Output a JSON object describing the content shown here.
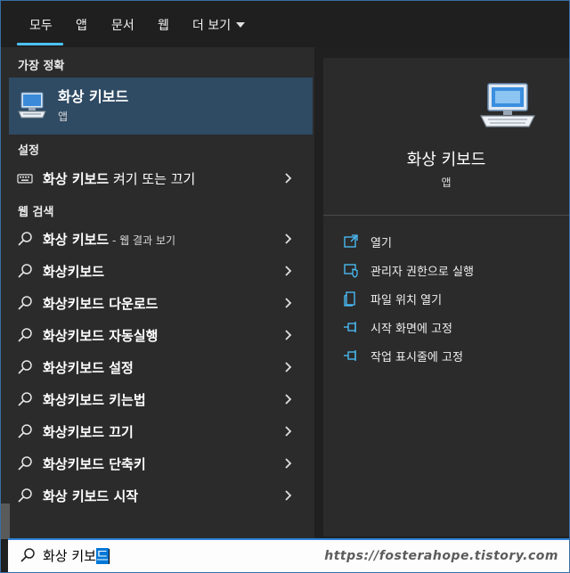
{
  "tabs": [
    {
      "label": "모두",
      "active": true
    },
    {
      "label": "앱"
    },
    {
      "label": "문서"
    },
    {
      "label": "웹"
    },
    {
      "label": "더 보기"
    }
  ],
  "best_match": {
    "section": "가장 정확",
    "title": "화상 키보드",
    "subtitle": "앱",
    "icon": "on-screen-keyboard-icon"
  },
  "settings": {
    "section": "설정",
    "item": {
      "bold": "화상 키보드",
      "rest": " 켜기 또는 끄기",
      "icon": "keyboard-icon"
    }
  },
  "web": {
    "section": "웹 검색",
    "items": [
      {
        "bold": "화상 키보드",
        "small": " - 웹 결과 보기"
      },
      {
        "bold": "화상키보드"
      },
      {
        "bold": "화상키보드 다운로드"
      },
      {
        "bold": "화상키보드 자동실행"
      },
      {
        "bold": "화상키보드 설정"
      },
      {
        "bold": "화상키보드 키는법"
      },
      {
        "bold": "화상키보드 끄기"
      },
      {
        "bold": "화상키보드 단축키"
      },
      {
        "bold": "화상 키보드 시작"
      }
    ]
  },
  "preview": {
    "title": "화상 키보드",
    "subtitle": "앱",
    "actions": [
      {
        "label": "열기",
        "icon": "open-icon"
      },
      {
        "label": "관리자 권한으로 실행",
        "icon": "shield-admin-icon"
      },
      {
        "label": "파일 위치 열기",
        "icon": "file-location-icon"
      },
      {
        "label": "시작 화면에 고정",
        "icon": "pin-icon"
      },
      {
        "label": "작업 표시줄에 고정",
        "icon": "pin-taskbar-icon"
      }
    ]
  },
  "search": {
    "typed": "화상 키보",
    "selected": "드"
  },
  "watermark": "https://fosterahope.tistory.com",
  "colors": {
    "accent": "#4cc2ff",
    "selection": "#0078d7",
    "best_bg": "#2f4a63"
  }
}
